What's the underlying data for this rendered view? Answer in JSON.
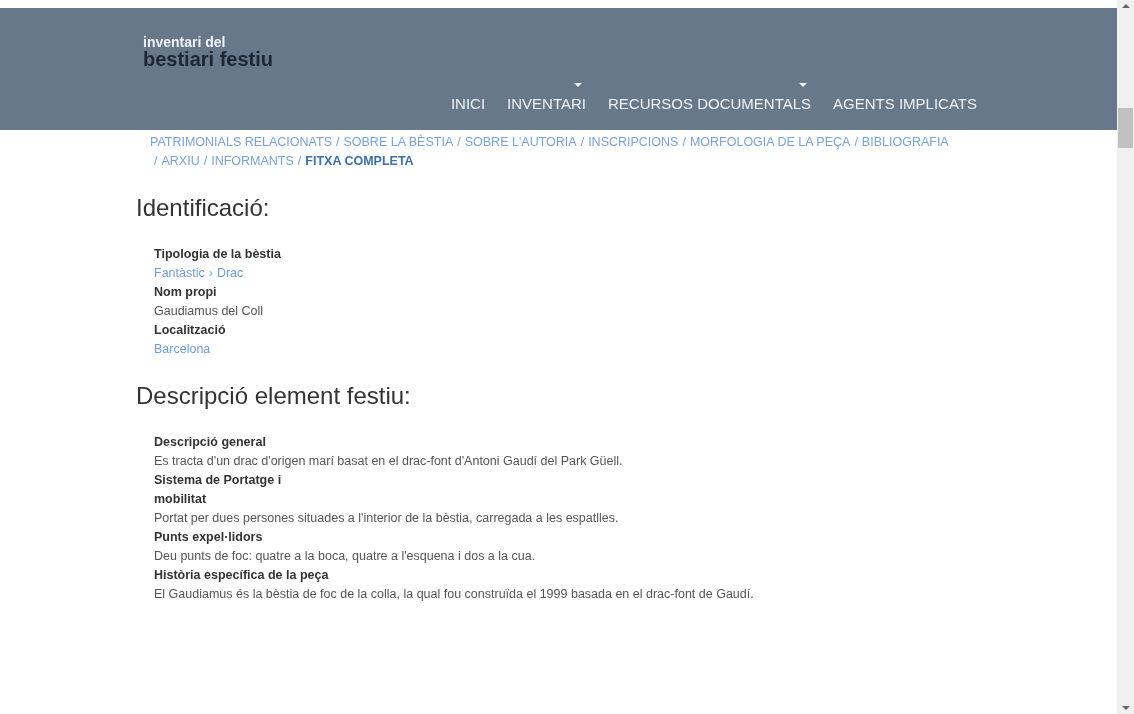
{
  "header": {
    "logo_line_1": "inventari del",
    "logo_line_2": "bestiari festiu",
    "nav": [
      {
        "label": "INICI",
        "has_dropdown": false
      },
      {
        "label": "INVENTARI",
        "has_dropdown": true
      },
      {
        "label": "RECURSOS DOCUMENTALS",
        "has_dropdown": true
      },
      {
        "label": "AGENTS IMPLICATS",
        "has_dropdown": false
      }
    ]
  },
  "breadcrumb": {
    "separator": "/",
    "items": [
      {
        "label": "PATRIMONIALS RELACIONATS",
        "selected": false
      },
      {
        "label": "SOBRE LA BÈSTIA",
        "selected": false
      },
      {
        "label": "SOBRE L'AUTORIA",
        "selected": false
      },
      {
        "label": "INSCRIPCIONS",
        "selected": false
      },
      {
        "label": "MORFOLOGIA DE LA PEÇA",
        "selected": false
      },
      {
        "label": "BIBLIOGRAFIA",
        "selected": false
      },
      {
        "label": "ARXIU",
        "selected": false
      },
      {
        "label": "INFORMANTS",
        "selected": false
      },
      {
        "label": "FITXA COMPLETA",
        "selected": true
      }
    ]
  },
  "sections": [
    {
      "title": "Identificació:",
      "fields": [
        {
          "label": "Tipologia de la bèstia",
          "kind": "links",
          "parts": [
            "Fantàstic",
            "Drac"
          ],
          "separator": "›"
        },
        {
          "label": "Nom propi",
          "kind": "text",
          "parts": [
            "Gaudiamus del Coll"
          ]
        },
        {
          "label": "Localització",
          "kind": "links",
          "parts": [
            "Barcelona"
          ]
        }
      ]
    },
    {
      "title": "Descripció element festiu:",
      "fields": [
        {
          "label": "Descripció general",
          "kind": "text",
          "parts": [
            "Es tracta d'un drac d'origen marí basat en el drac-font d'Antoni Gaudí del Park Güell."
          ]
        },
        {
          "label": "Sistema de Portatge i mobilitat",
          "kind": "text",
          "parts": [
            "Portat per dues persones situades a l'interior de la bèstia, carregada a les espatlles."
          ]
        },
        {
          "label": "Punts expel·lidors",
          "kind": "text",
          "parts": [
            "Deu punts de foc: quatre a la boca, quatre a l'esquena i dos a la cua."
          ]
        },
        {
          "label": "Història específica de la peça",
          "kind": "text",
          "parts": [
            "El Gaudiamus és la bèstia de foc de la colla, la qual fou construïda el 1999 basada en el drac-font de Gaudí."
          ]
        }
      ]
    }
  ]
}
